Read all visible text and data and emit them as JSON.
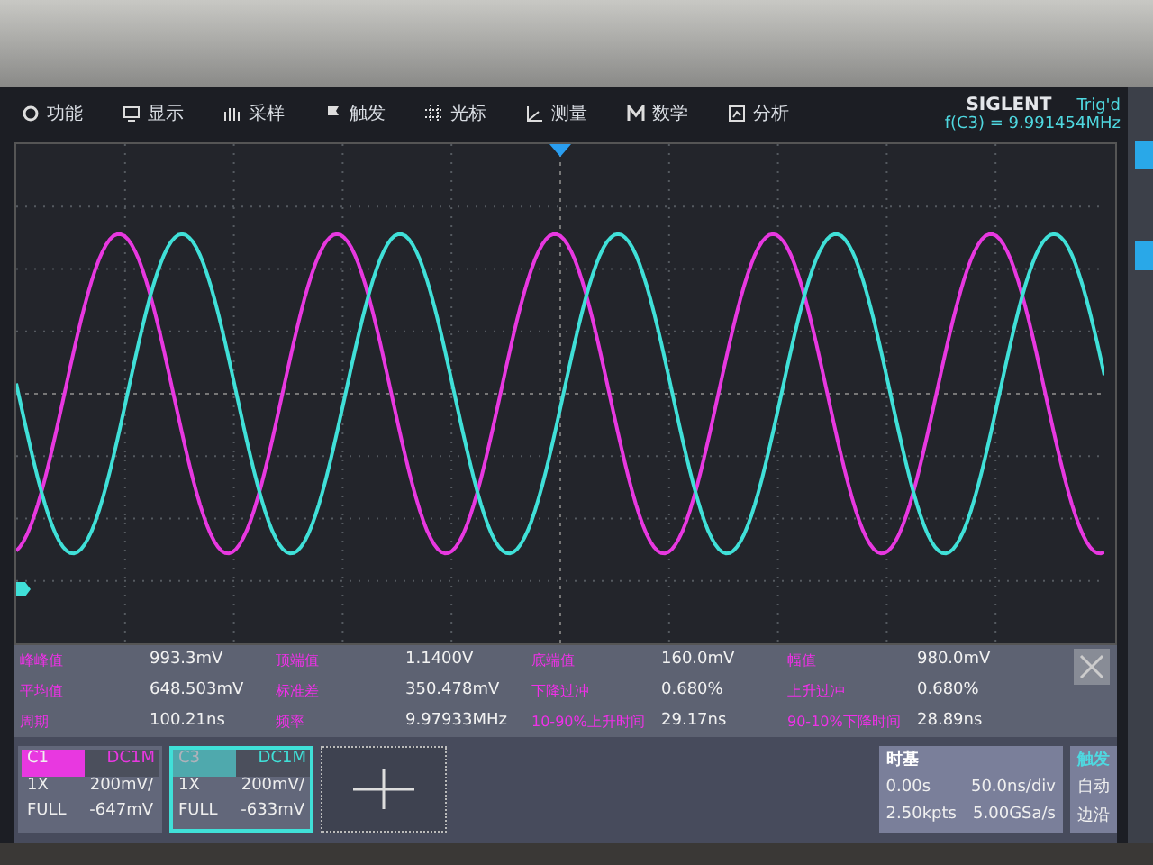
{
  "menu": [
    {
      "label": "功能"
    },
    {
      "label": "显示"
    },
    {
      "label": "采样"
    },
    {
      "label": "触发"
    },
    {
      "label": "光标"
    },
    {
      "label": "测量"
    },
    {
      "label": "数学"
    },
    {
      "label": "分析"
    }
  ],
  "brand": "SIGLENT",
  "trigger_status": "Trig'd",
  "frequency_readout": "f(C3) = 9.991454MHz",
  "measurements": [
    {
      "label": "峰峰值",
      "value": "993.3mV"
    },
    {
      "label": "顶端值",
      "value": "1.1400V"
    },
    {
      "label": "底端值",
      "value": "160.0mV"
    },
    {
      "label": "幅值",
      "value": "980.0mV"
    },
    {
      "label": "平均值",
      "value": "648.503mV"
    },
    {
      "label": "标准差",
      "value": "350.478mV"
    },
    {
      "label": "下降过冲",
      "value": "0.680%"
    },
    {
      "label": "上升过冲",
      "value": "0.680%"
    },
    {
      "label": "周期",
      "value": "100.21ns"
    },
    {
      "label": "频率",
      "value": "9.97933MHz"
    },
    {
      "label": "10-90%上升时间",
      "value": "29.17ns"
    },
    {
      "label": "90-10%下降时间",
      "value": "28.89ns"
    }
  ],
  "channels": [
    {
      "name": "C1",
      "coupling": "DC1M",
      "probe": "1X",
      "scale": "200mV/",
      "bandwidth": "FULL",
      "offset": "-647mV",
      "color": "#e838e0",
      "selected": false
    },
    {
      "name": "C3",
      "coupling": "DC1M",
      "probe": "1X",
      "scale": "200mV/",
      "bandwidth": "FULL",
      "offset": "-633mV",
      "color": "#40e0d8",
      "selected": true
    }
  ],
  "timebase": {
    "title": "时基",
    "delay": "0.00s",
    "scale": "50.0ns/div",
    "memory": "2.50kpts",
    "sample_rate": "5.00GSa/s"
  },
  "trigger": {
    "title": "触发",
    "mode": "自动",
    "type": "边沿"
  }
}
